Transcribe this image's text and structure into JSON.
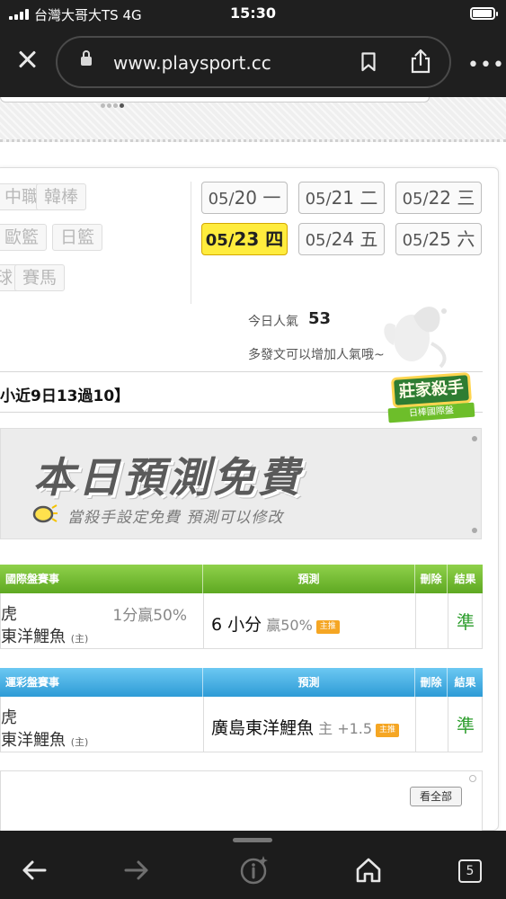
{
  "status_bar": {
    "carrier": "台灣大哥大TS  4G",
    "time": "15:30",
    "battery_level": 0.95
  },
  "browser": {
    "url": "www.playsport.cc",
    "icons": [
      "close-icon",
      "lock-icon",
      "bookmark-icon",
      "share-icon",
      "more-icon"
    ]
  },
  "categories": {
    "row1": [
      "中職",
      "韓棒"
    ],
    "row2": [
      "歐籃",
      "日籃"
    ],
    "row3": [
      "球",
      "賽馬"
    ]
  },
  "dates": [
    {
      "md": "05/",
      "day": "20",
      "weekday": "一",
      "active": false
    },
    {
      "md": "05/",
      "day": "21",
      "weekday": "二",
      "active": false
    },
    {
      "md": "05/",
      "day": "22",
      "weekday": "三",
      "active": false
    },
    {
      "md": "05/",
      "day": "23",
      "weekday": "四",
      "active": true
    },
    {
      "md": "05/",
      "day": "24",
      "weekday": "五",
      "active": false
    },
    {
      "md": "05/",
      "day": "25",
      "weekday": "六",
      "active": false
    }
  ],
  "popularity": {
    "label": "今日人氣",
    "value": "53",
    "hint": "多發文可以增加人氣哦~"
  },
  "record": {
    "text": "小近9日13過10】"
  },
  "badge": {
    "title": "莊家殺手",
    "subtitle": "日棒國際盤"
  },
  "banner": {
    "title": "本日預測免費",
    "subtitle": "當殺手設定免費  預測可以修改"
  },
  "international_table": {
    "headers": {
      "game": "國際盤賽事",
      "prediction": "預測",
      "delete": "刪除",
      "result": "結果"
    },
    "row": {
      "team_away": "虎",
      "team_home": "東洋鯉魚",
      "home_mark": "(主)",
      "odds": "1分贏50%",
      "prediction": "6 小分",
      "prediction_extra": "贏50%",
      "tag": "主推",
      "result": "準"
    }
  },
  "sports_lottery_table": {
    "headers": {
      "game": "運彩盤賽事",
      "prediction": "預測",
      "delete": "刪除",
      "result": "結果"
    },
    "row": {
      "team_away": "虎",
      "team_home": "東洋鯉魚",
      "home_mark": "(主)",
      "prediction": "廣島東洋鯉魚",
      "prediction_extra": "主 +1.5",
      "tag": "主推",
      "result": "準"
    }
  },
  "view_all": "看全部",
  "toolbar": {
    "tabs_count": "5",
    "icons": [
      "back-arrow-icon",
      "forward-arrow-icon",
      "sparkle-info-icon",
      "home-icon",
      "tabs-icon"
    ]
  }
}
